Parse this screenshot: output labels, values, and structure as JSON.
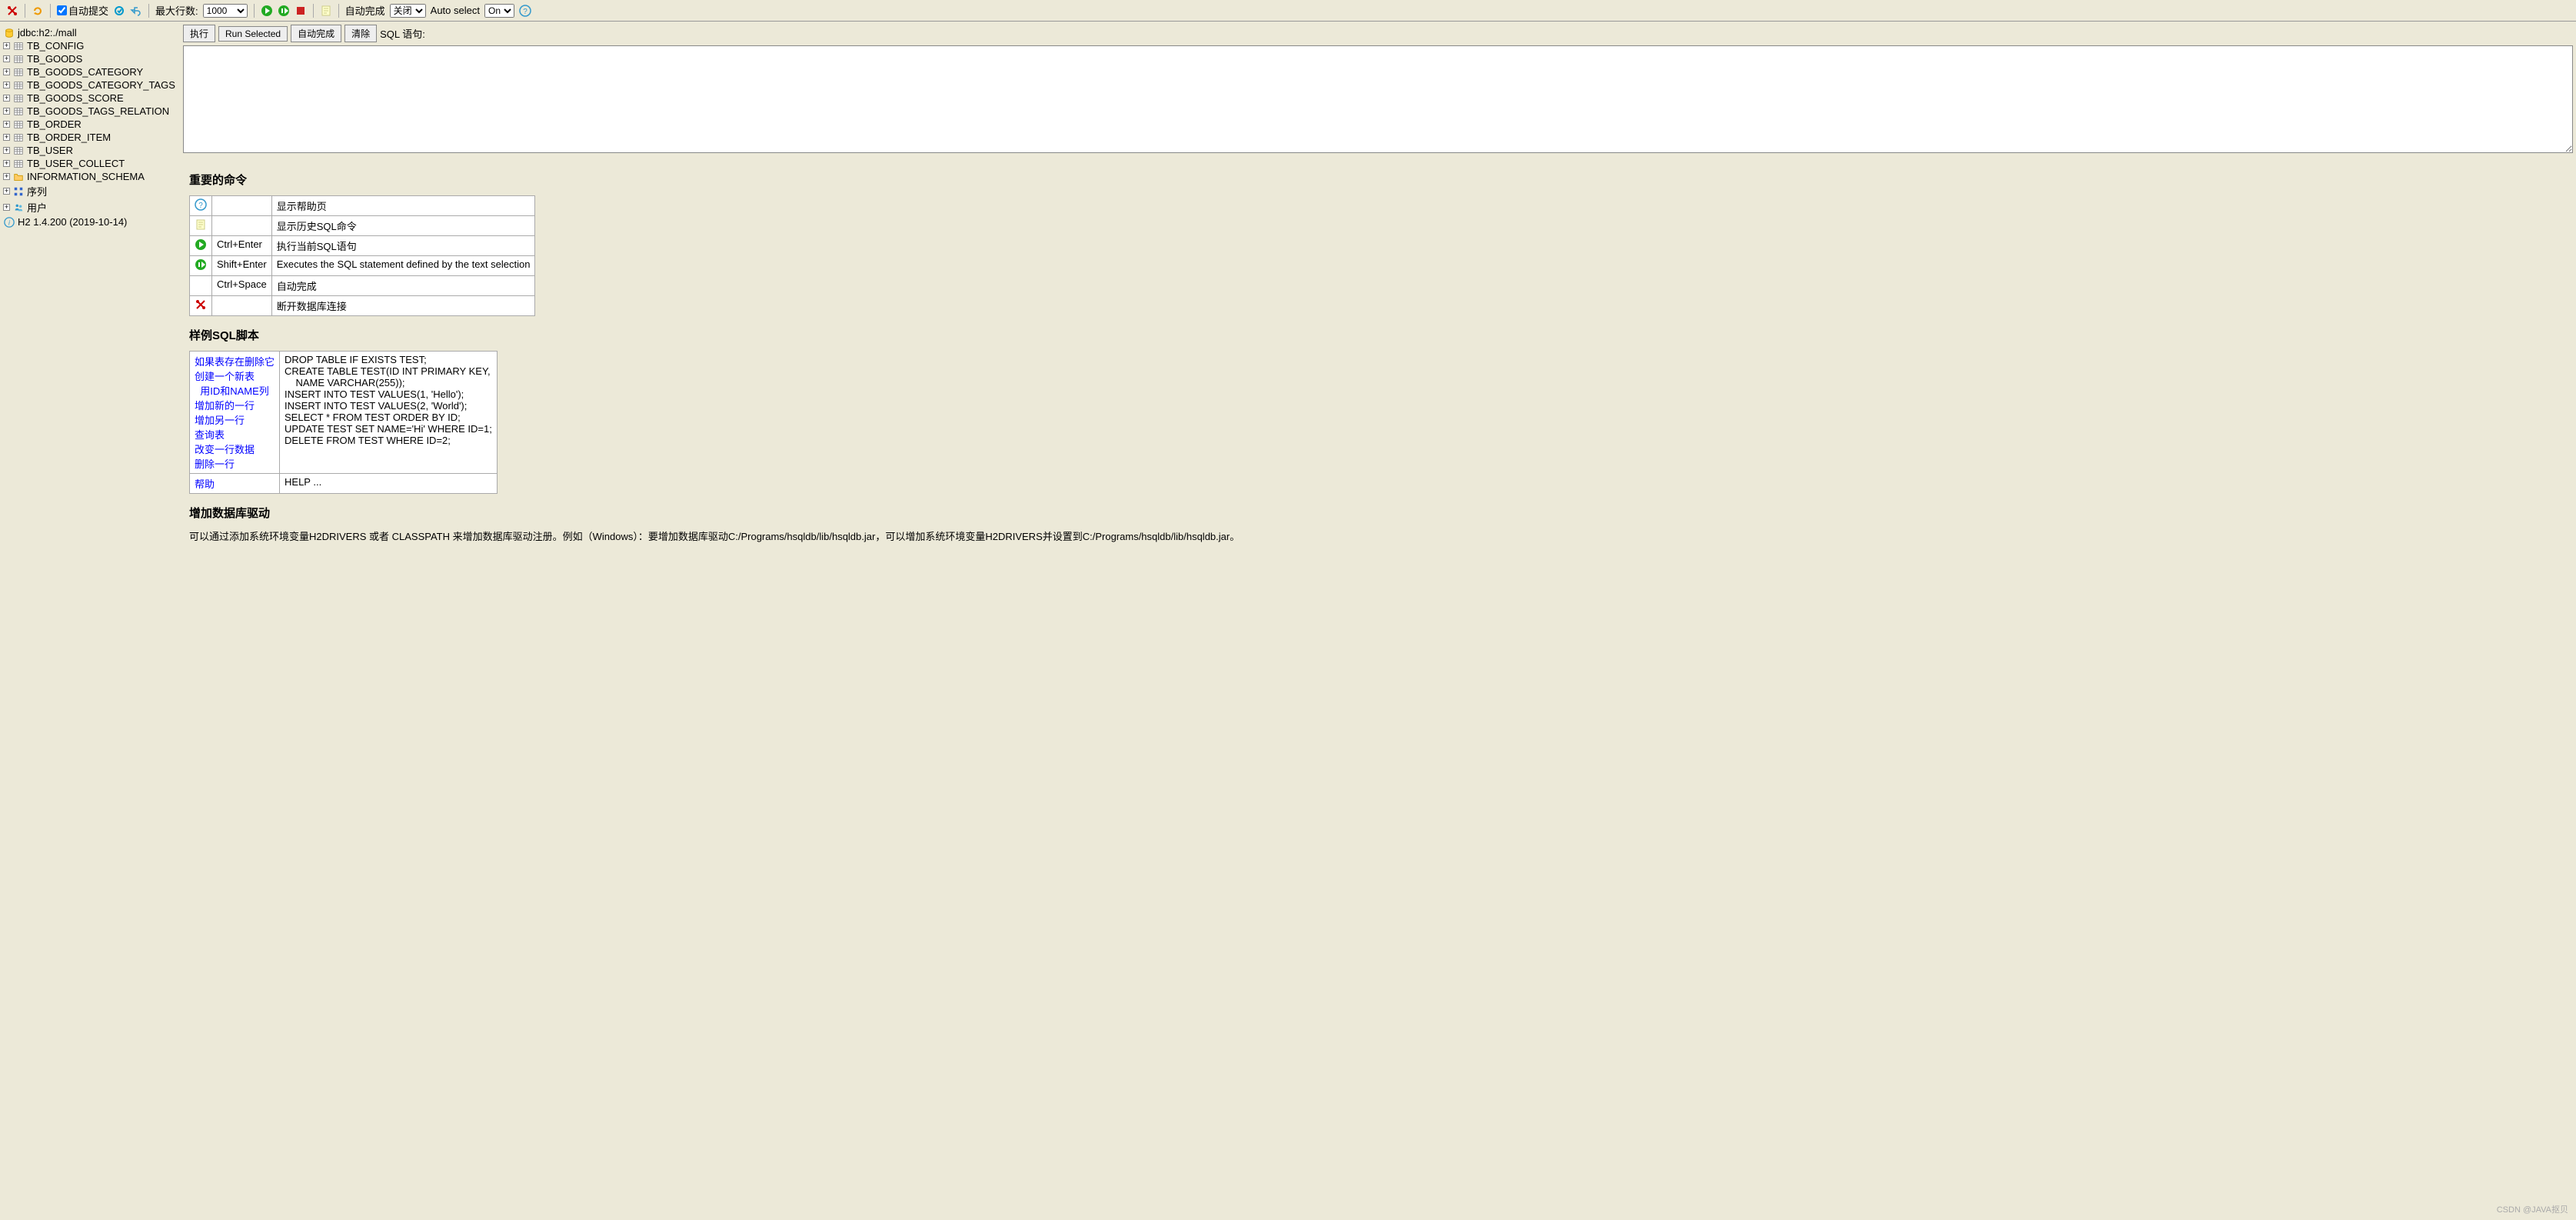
{
  "toolbar": {
    "auto_commit_label": "自动提交",
    "max_rows_label": "最大行数:",
    "max_rows_value": "1000",
    "auto_complete_label": "自动完成",
    "auto_complete_value": "关闭",
    "auto_complete_options": [
      "关闭"
    ],
    "auto_select_label": "Auto select",
    "auto_select_value": "On",
    "auto_select_options": [
      "On"
    ]
  },
  "sidebar": {
    "db_url": "jdbc:h2:./mall",
    "tables": [
      "TB_CONFIG",
      "TB_GOODS",
      "TB_GOODS_CATEGORY",
      "TB_GOODS_CATEGORY_TAGS",
      "TB_GOODS_SCORE",
      "TB_GOODS_TAGS_RELATION",
      "TB_ORDER",
      "TB_ORDER_ITEM",
      "TB_USER",
      "TB_USER_COLLECT"
    ],
    "schema": "INFORMATION_SCHEMA",
    "sequences": "序列",
    "users": "用户",
    "version": "H2 1.4.200 (2019-10-14)"
  },
  "cmdbar": {
    "run": "执行",
    "run_selected": "Run Selected",
    "auto_complete": "自动完成",
    "clear": "清除",
    "sql_label": "SQL 语句:"
  },
  "headings": {
    "important": "重要的命令",
    "samples": "样例SQL脚本",
    "drivers": "增加数据库驱动"
  },
  "commands": [
    {
      "icon": "help",
      "shortcut": "",
      "desc": "显示帮助页"
    },
    {
      "icon": "history",
      "shortcut": "",
      "desc": "显示历史SQL命令"
    },
    {
      "icon": "run",
      "shortcut": "Ctrl+Enter",
      "desc": "执行当前SQL语句"
    },
    {
      "icon": "run-sel",
      "shortcut": "Shift+Enter",
      "desc": "Executes the SQL statement defined by the text selection"
    },
    {
      "icon": "",
      "shortcut": "Ctrl+Space",
      "desc": "自动完成"
    },
    {
      "icon": "disconnect",
      "shortcut": "",
      "desc": "断开数据库连接"
    }
  ],
  "samples": [
    {
      "label": "如果表存在删除它",
      "sql": "DROP TABLE IF EXISTS TEST;"
    },
    {
      "label": "创建一个新表",
      "sql": "CREATE TABLE TEST(ID INT PRIMARY KEY,"
    },
    {
      "label": "  用ID和NAME列",
      "sql": "    NAME VARCHAR(255));"
    },
    {
      "label": "增加新的一行",
      "sql": "INSERT INTO TEST VALUES(1, 'Hello');"
    },
    {
      "label": "增加另一行",
      "sql": "INSERT INTO TEST VALUES(2, 'World');"
    },
    {
      "label": "查询表",
      "sql": "SELECT * FROM TEST ORDER BY ID;"
    },
    {
      "label": "改变一行数据",
      "sql": "UPDATE TEST SET NAME='Hi' WHERE ID=1;"
    },
    {
      "label": "删除一行",
      "sql": "DELETE FROM TEST WHERE ID=2;"
    }
  ],
  "help_row": {
    "label": "帮助",
    "sql": "HELP ..."
  },
  "driver_text": "可以通过添加系统环境变量H2DRIVERS 或者 CLASSPATH 来增加数据库驱动注册。例如（Windows）：要增加数据库驱动C:/Programs/hsqldb/lib/hsqldb.jar，可以增加系统环境变量H2DRIVERS并设置到C:/Programs/hsqldb/lib/hsqldb.jar。",
  "watermark": "CSDN @JAVA抠贝"
}
